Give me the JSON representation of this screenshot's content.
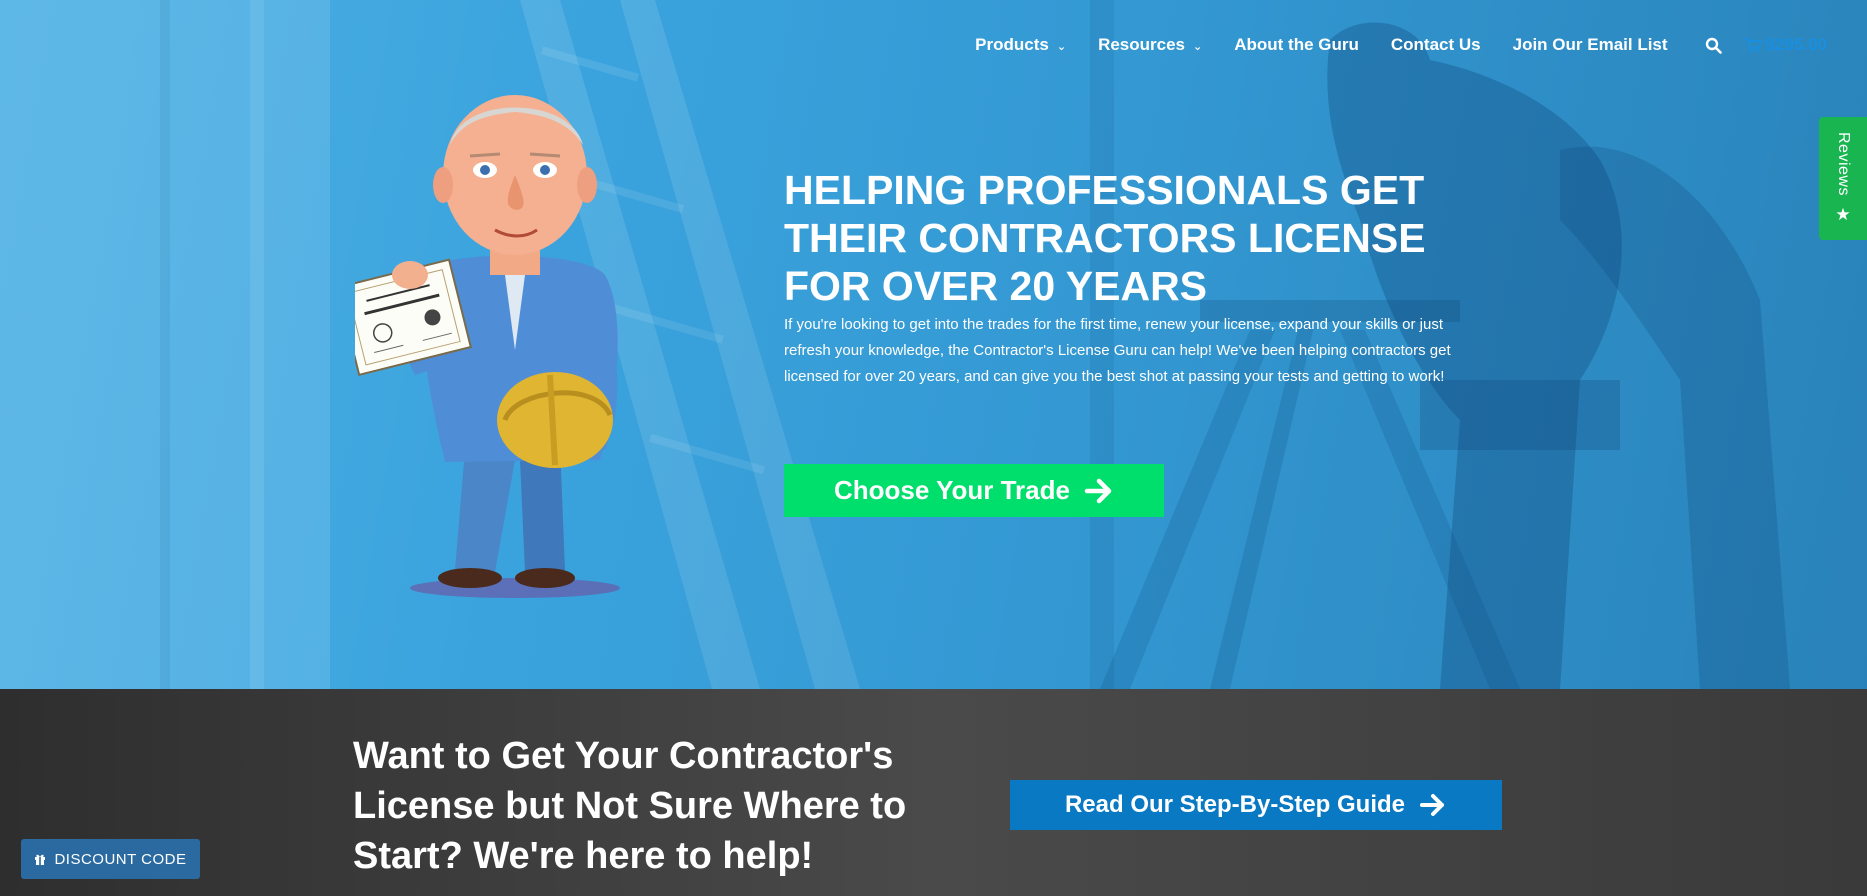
{
  "nav": {
    "items": [
      {
        "label": "Products",
        "has_dropdown": true
      },
      {
        "label": "Resources",
        "has_dropdown": true
      },
      {
        "label": "About the Guru",
        "has_dropdown": false
      },
      {
        "label": "Contact Us",
        "has_dropdown": false
      },
      {
        "label": "Join Our Email List",
        "has_dropdown": false
      }
    ],
    "search_icon": "search-icon",
    "cart_icon": "cart-icon",
    "cart_amount": "$295.00",
    "cart_color": "#1a8fe0"
  },
  "reviews_tab": {
    "label": "Reviews",
    "icon": "star-icon",
    "color": "#18b551"
  },
  "hero": {
    "title": "HELPING PROFESSIONALS GET THEIR CONTRACTORS LICENSE FOR OVER 20 YEARS",
    "text": "If you're looking to get into the trades for the first time, renew your license, expand your skills or just refresh your knowledge, the Contractor's License Guru can help! We've been helping contractors get licensed for over 20 years, and can give you the best shot at passing your tests and getting to work!",
    "cta_label": "Choose Your Trade",
    "cta_icon": "arrow-right-icon",
    "background_color": "#3aa3dd",
    "cta_color": "#00de6b"
  },
  "band": {
    "title": "Want to Get Your Contractor's License but Not Sure Where to Start? We're here to help!",
    "cta_label": "Read Our Step-By-Step Guide",
    "cta_icon": "arrow-right-icon",
    "cta_color": "#0979c3"
  },
  "discount": {
    "label": "DISCOUNT CODE",
    "icon": "gift-icon",
    "color": "#2b6aa0"
  }
}
